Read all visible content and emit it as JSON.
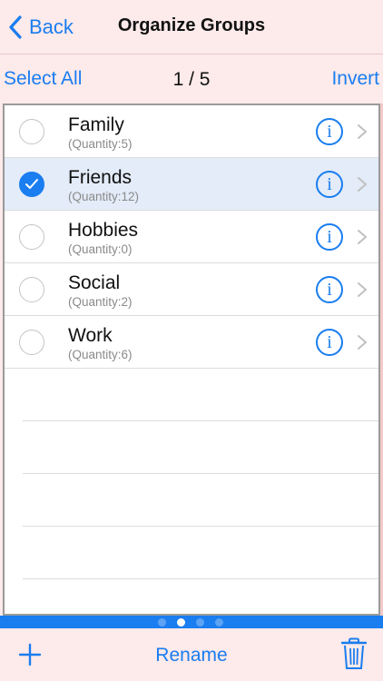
{
  "nav": {
    "back_label": "Back",
    "title": "Organize Groups"
  },
  "toolbar": {
    "select_all": "Select All",
    "page_indicator": "1 / 5",
    "invert": "Invert"
  },
  "groups": [
    {
      "name": "Family",
      "quantity": "(Quantity:5)",
      "selected": false
    },
    {
      "name": "Friends",
      "quantity": "(Quantity:12)",
      "selected": true
    },
    {
      "name": "Hobbies",
      "quantity": "(Quantity:0)",
      "selected": false
    },
    {
      "name": "Social",
      "quantity": "(Quantity:2)",
      "selected": false
    },
    {
      "name": "Work",
      "quantity": "(Quantity:6)",
      "selected": false
    }
  ],
  "info_glyph": "i",
  "pager": {
    "count": 4,
    "active_index": 1
  },
  "bottombar": {
    "rename": "Rename"
  },
  "colors": {
    "accent": "#1a7df0",
    "background": "#fdeaea",
    "selected_row": "#e3ecf8"
  },
  "icons": {
    "back": "chevron-left-icon",
    "info": "info-icon",
    "disclosure": "chevron-right-icon",
    "add": "plus-icon",
    "trash": "trash-icon",
    "check": "checkmark-icon"
  }
}
